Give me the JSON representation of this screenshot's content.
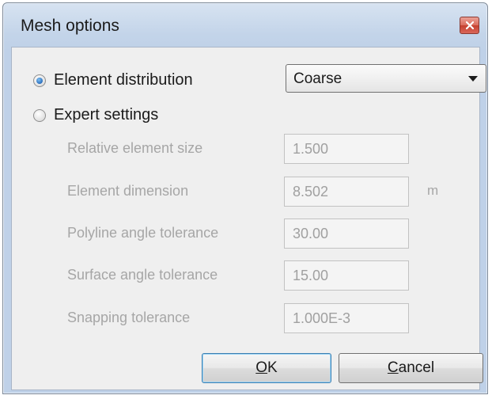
{
  "window": {
    "title": "Mesh options"
  },
  "mesh": {
    "element_distribution_label": "Element distribution",
    "expert_settings_label": "Expert settings",
    "selected_mode": "element_distribution",
    "distribution_value": "Coarse"
  },
  "fields": [
    {
      "label": "Relative element size",
      "value": "1.500"
    },
    {
      "label": "Element dimension",
      "value": "8.502",
      "unit": "m"
    },
    {
      "label": "Polyline angle tolerance",
      "value": "30.00"
    },
    {
      "label": "Surface angle tolerance",
      "value": "15.00"
    },
    {
      "label": "Snapping tolerance",
      "value": "1.000E-3"
    }
  ],
  "buttons": {
    "ok_label": "OK",
    "ok_mnemonic": "O",
    "ok_rest": "K",
    "cancel_label": "Cancel",
    "cancel_mnemonic": "C",
    "cancel_rest": "ancel"
  },
  "icons": {
    "close": "close-icon",
    "dropdown": "chevron-down-icon"
  }
}
